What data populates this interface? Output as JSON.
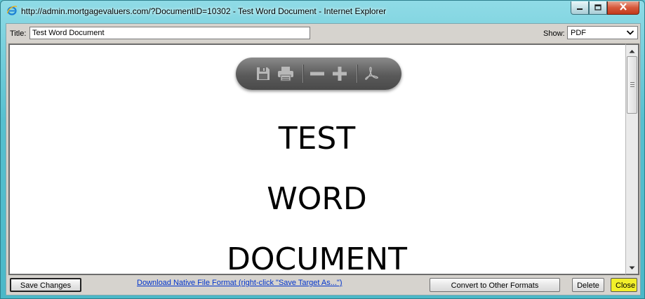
{
  "window": {
    "title": "http://admin.mortgagevaluers.com/?DocumentID=10302 - Test Word Document - Internet Explorer"
  },
  "toolbar": {
    "title_label": "Title:",
    "title_value": "Test Word Document",
    "show_label": "Show:",
    "show_value": "PDF"
  },
  "document": {
    "lines": [
      "TEST",
      "WORD",
      "DOCUMENT"
    ]
  },
  "pdf_toolbar": {
    "icons": [
      "save-icon",
      "print-icon",
      "zoom-out-icon",
      "zoom-in-icon",
      "acrobat-icon"
    ]
  },
  "bottombar": {
    "save_label": "Save Changes",
    "download_link": "Download Native File Format (right-click \"Save Target As...\")",
    "convert_label": "Convert to Other Formats",
    "delete_label": "Delete",
    "close_label": "Close"
  },
  "colors": {
    "frame": "#56c0cf",
    "close_button": "#f2ef2a",
    "link": "#0033cc"
  }
}
